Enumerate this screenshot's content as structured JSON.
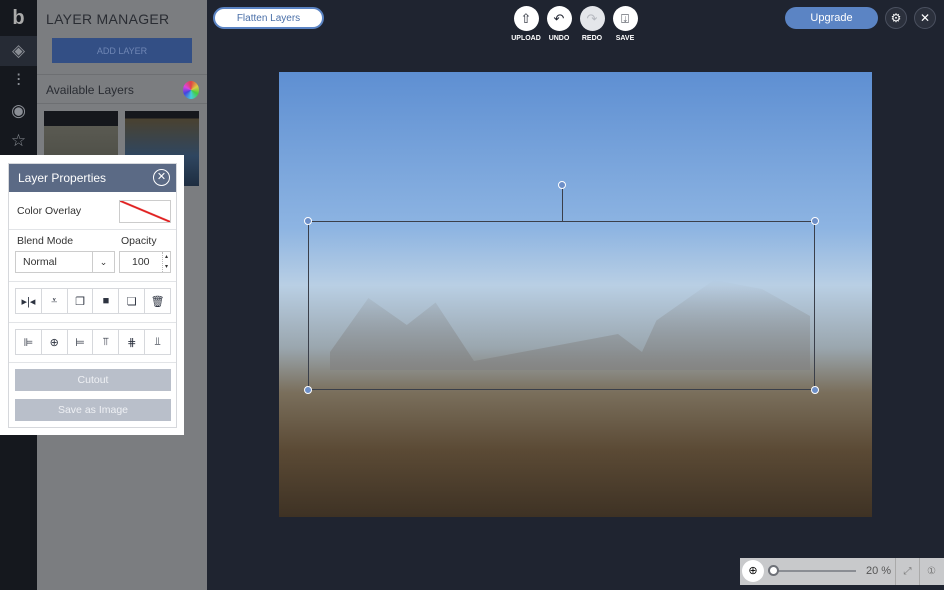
{
  "sidebar": {
    "icons": [
      "logo-icon",
      "layers-icon",
      "adjustments-icon",
      "eye-icon",
      "star-icon"
    ]
  },
  "layer_manager": {
    "title": "LAYER MANAGER",
    "add_layer": "ADD LAYER",
    "available_layers": "Available Layers"
  },
  "layer_properties": {
    "title": "Layer Properties",
    "color_overlay": "Color Overlay",
    "blend_mode_label": "Blend Mode",
    "blend_mode_value": "Normal",
    "opacity_label": "Opacity",
    "opacity_value": "100",
    "transform_buttons": [
      "▸|◂",
      "⩡",
      "❐",
      "■",
      "❏",
      "🗑"
    ],
    "align_buttons": [
      "⊫",
      "⊕",
      "⊨",
      "⫪",
      "⋕",
      "⫫"
    ],
    "cutout": "Cutout",
    "save_as_image": "Save as Image"
  },
  "toolbar": {
    "flatten": "Flatten Layers",
    "upload": "UPLOAD",
    "undo": "UNDO",
    "redo": "REDO",
    "save": "SAVE",
    "upgrade": "Upgrade"
  },
  "zoom": {
    "value": "20 %",
    "level": 0.05
  },
  "colors": {
    "accent": "#5b84c4",
    "header": "#5b6a85",
    "bg": "#1f2430"
  }
}
